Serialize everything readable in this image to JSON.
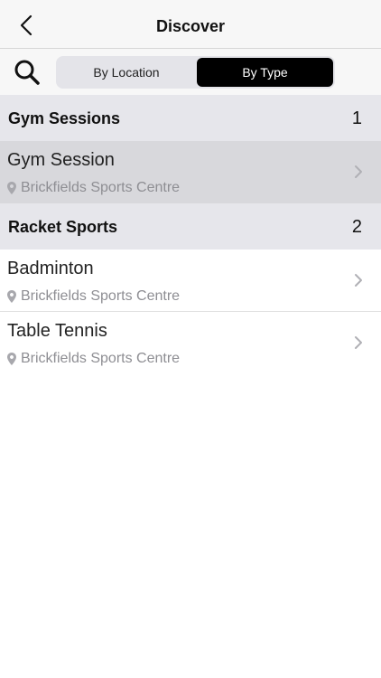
{
  "header": {
    "title": "Discover",
    "back_icon": "chevron-left-icon"
  },
  "filter": {
    "search_icon": "search-icon",
    "segments": [
      "By Location",
      "By Type"
    ],
    "selected": "By Type"
  },
  "sections": [
    {
      "title": "Gym Sessions",
      "count": "1",
      "items": [
        {
          "name": "Gym Session",
          "location": "Brickfields Sports Centre",
          "selected": true
        }
      ]
    },
    {
      "title": "Racket Sports",
      "count": "2",
      "items": [
        {
          "name": "Badminton",
          "location": "Brickfields Sports Centre",
          "selected": false
        },
        {
          "name": "Table Tennis",
          "location": "Brickfields Sports Centre",
          "selected": false
        }
      ]
    }
  ],
  "colors": {
    "accent": "#000000",
    "section_bg": "#e6e6eb",
    "selected_row_bg": "#d8d8dc",
    "secondary_text": "#8e8e93"
  }
}
